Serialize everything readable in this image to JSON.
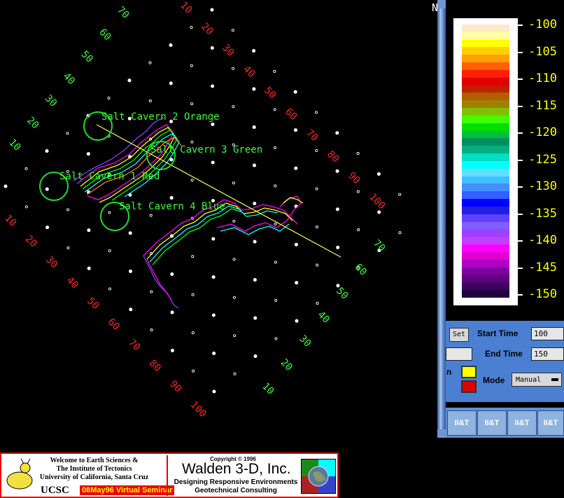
{
  "viz": {
    "top_right_label": "N",
    "cavern_labels": [
      "Salt Cavern 2 Orange",
      "Salt Cavern 3 Green",
      "Salt Cavern 1 Red",
      "Salt Cavern 4 Blue"
    ],
    "axis_ticks_upper_left_green": [
      "70",
      "60",
      "50",
      "40",
      "30",
      "20",
      "10"
    ],
    "axis_ticks_upper_right_red": [
      "10",
      "20",
      "30",
      "40",
      "50",
      "60",
      "70",
      "80",
      "90",
      "100"
    ],
    "axis_ticks_lower_left_red": [
      "10",
      "20",
      "30",
      "40",
      "50",
      "60",
      "70",
      "80",
      "90",
      "100"
    ],
    "axis_ticks_lower_right_green": [
      "70",
      "60",
      "50",
      "40",
      "30",
      "20",
      "10"
    ]
  },
  "colorbar": {
    "labels": [
      "-100",
      "-105",
      "-110",
      "-115",
      "-120",
      "-125",
      "-130",
      "-135",
      "-140",
      "-145",
      "-150"
    ],
    "colors": [
      "#ffe8c8",
      "#ffffa0",
      "#ffff00",
      "#ffd000",
      "#ffa000",
      "#ff6000",
      "#ff2000",
      "#e00000",
      "#c02000",
      "#b06000",
      "#a08000",
      "#80c000",
      "#40ff00",
      "#00e000",
      "#00c040",
      "#009060",
      "#00b080",
      "#00e0c0",
      "#00ffff",
      "#60e0ff",
      "#40c0ff",
      "#4090ff",
      "#3060ff",
      "#0000ff",
      "#2020e0",
      "#6040ff",
      "#8060ff",
      "#a040ff",
      "#c040ff",
      "#ff00ff",
      "#e000d0",
      "#b000c0",
      "#8000a0",
      "#600080",
      "#400060",
      "#200040"
    ]
  },
  "controls": {
    "set_button": "Set",
    "start_time_label": "Start Time",
    "start_time_value": "100",
    "end_time_label": "End Time",
    "end_time_value": "150",
    "left_cut_label": "n",
    "swatch_1_color": "#ffff00",
    "swatch_2_color": "#dd0000",
    "mode_label": "Mode",
    "mode_value": "Manual"
  },
  "logos": {
    "tile_label": "II&T"
  },
  "footer": {
    "welcome_line1": "Welcome to Earth Sciences &",
    "welcome_line2": "The Institute of Tectonics",
    "welcome_line3": "University of California, Santa Cruz",
    "ucsc": "UCSC",
    "seminar": "08May96 Virtual Seminar",
    "copyright": "Copyright © 1996",
    "company": "Walden 3-D, Inc.",
    "tagline1": "Designing Responsive Environments",
    "tagline2": "Geotechnical Consulting"
  }
}
